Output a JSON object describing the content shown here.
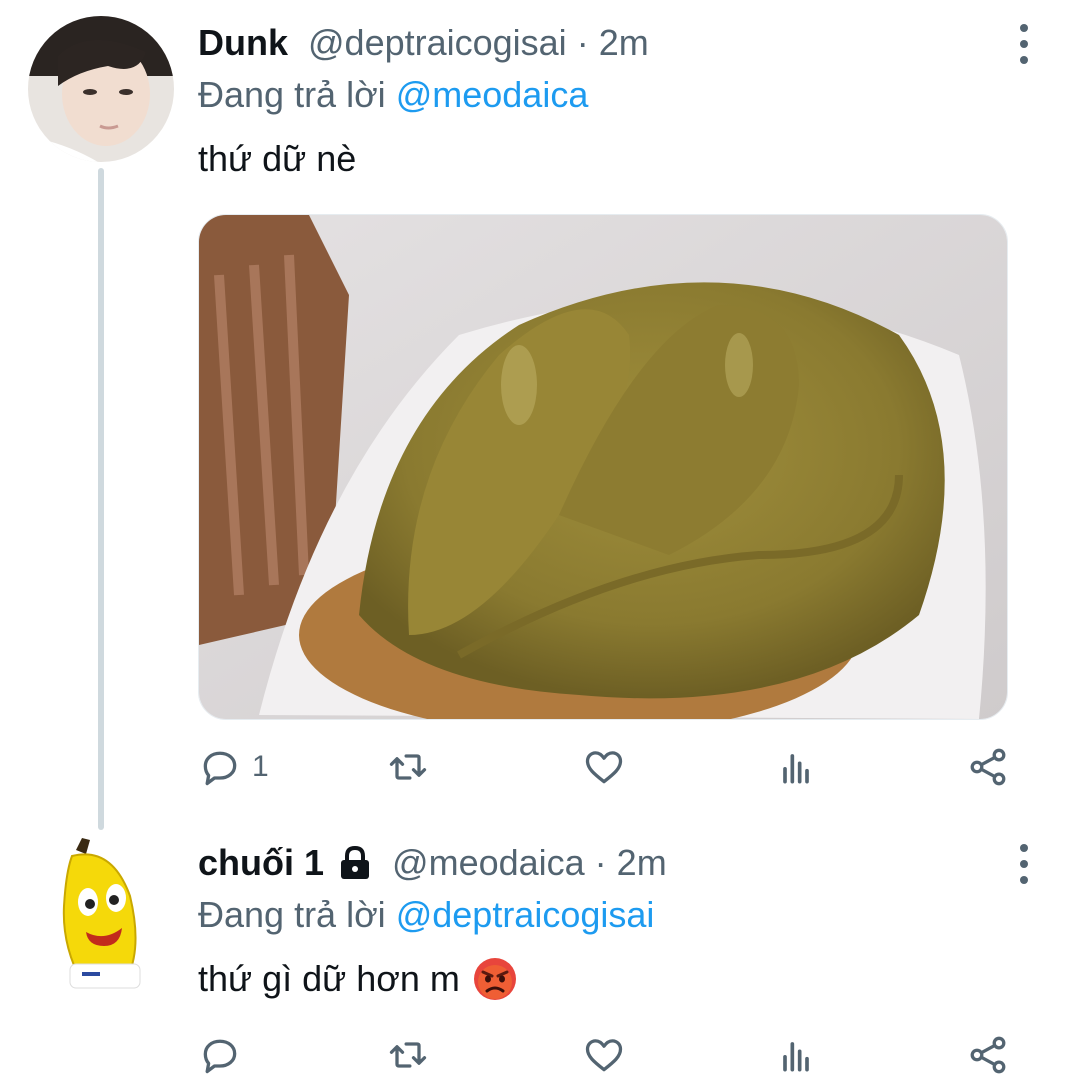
{
  "tweets": [
    {
      "name": "Dunk",
      "handle": "@deptraicogisai",
      "separator": "·",
      "time": "2m",
      "reply_prefix": "Đang trả lời",
      "reply_to": "@meodaica",
      "text": "thứ dữ nè",
      "reply_count": "1",
      "avatar_icon": "person-photo",
      "media_icon": "photo-brown-swirl-cupcake"
    },
    {
      "name": "chuối 1",
      "handle": "@meodaica",
      "separator": "·",
      "time": "2m",
      "reply_prefix": "Đang trả lời",
      "reply_to": "@deptraicogisai",
      "text": "thứ gì dữ hơn m",
      "emoji": "😡",
      "avatar_icon": "banana-cartoon",
      "protected_icon": "lock-icon"
    }
  ],
  "colors": {
    "accent": "#1d9bf0",
    "secondary_text": "#536471",
    "thread_line": "#cfd9de"
  }
}
